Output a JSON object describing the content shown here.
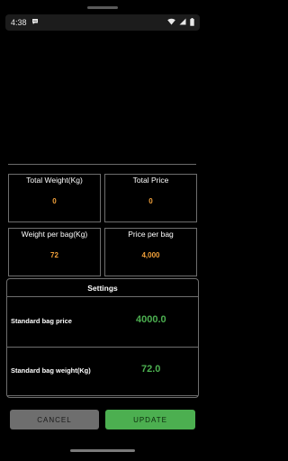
{
  "status_bar": {
    "time": "4:38",
    "icons": [
      "chat-bubble-icon",
      "wifi-icon",
      "signal-icon",
      "battery-icon"
    ]
  },
  "summary": {
    "total_weight_label": "Total Weight(Kg)",
    "total_weight_value": "0",
    "total_price_label": "Total Price",
    "total_price_value": "0",
    "weight_per_bag_label": "Weight per bag(Kg)",
    "weight_per_bag_value": "72",
    "price_per_bag_label": "Price per bag",
    "price_per_bag_value": "4,000"
  },
  "settings": {
    "title": "Settings",
    "standard_bag_price_label": "Standard bag price",
    "standard_bag_price_value": "4000.0",
    "standard_bag_weight_label": "Standard bag weight(Kg)",
    "standard_bag_weight_value": "72.0"
  },
  "actions": {
    "cancel_label": "CANCEL",
    "update_label": "UPDATE"
  },
  "colors": {
    "background": "#000000",
    "value_orange": "#f2a13a",
    "value_green": "#4caf50",
    "cancel_button": "#6e6e6e",
    "update_button": "#4caf50"
  }
}
